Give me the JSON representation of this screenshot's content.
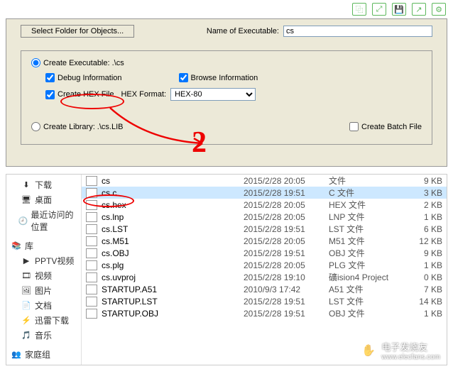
{
  "toolbar": {
    "select_folder": "Select Folder for Objects...",
    "name_of_exec_label": "Name of Executable:",
    "name_of_exec_value": "cs"
  },
  "options": {
    "create_exec_label": "Create Executable:  .\\cs",
    "debug_info_label": "Debug Information",
    "browse_info_label": "Browse Information",
    "create_hex_label": "Create HEX File",
    "hex_format_label": "HEX Format:",
    "hex_format_value": "HEX-80",
    "create_lib_label": "Create Library:  .\\cs.LIB",
    "create_batch_label": "Create Batch File"
  },
  "annotation": {
    "number": "2"
  },
  "nav": {
    "downloads": "下载",
    "desktop": "桌面",
    "recent": "最近访问的位置",
    "libraries": "库",
    "pptv": "PPTV视频",
    "videos": "视频",
    "pictures": "图片",
    "documents": "文档",
    "thunder": "迅雷下载",
    "music": "音乐",
    "homegroup": "家庭组"
  },
  "files": [
    {
      "name": "cs",
      "date": "2015/2/28 20:05",
      "type": "文件",
      "size": "9 KB"
    },
    {
      "name": "cs.c",
      "date": "2015/2/28 19:51",
      "type": "C 文件",
      "size": "3 KB"
    },
    {
      "name": "cs.hex",
      "date": "2015/2/28 20:05",
      "type": "HEX 文件",
      "size": "2 KB"
    },
    {
      "name": "cs.lnp",
      "date": "2015/2/28 20:05",
      "type": "LNP 文件",
      "size": "1 KB"
    },
    {
      "name": "cs.LST",
      "date": "2015/2/28 19:51",
      "type": "LST 文件",
      "size": "6 KB"
    },
    {
      "name": "cs.M51",
      "date": "2015/2/28 20:05",
      "type": "M51 文件",
      "size": "12 KB"
    },
    {
      "name": "cs.OBJ",
      "date": "2015/2/28 19:51",
      "type": "OBJ 文件",
      "size": "9 KB"
    },
    {
      "name": "cs.plg",
      "date": "2015/2/28 20:05",
      "type": "PLG 文件",
      "size": "1 KB"
    },
    {
      "name": "cs.uvproj",
      "date": "2015/2/28 19:10",
      "type": "礦ision4 Project",
      "size": "0 KB"
    },
    {
      "name": "STARTUP.A51",
      "date": "2010/9/3 17:42",
      "type": "A51 文件",
      "size": "7 KB"
    },
    {
      "name": "STARTUP.LST",
      "date": "2015/2/28 19:51",
      "type": "LST 文件",
      "size": "14 KB"
    },
    {
      "name": "STARTUP.OBJ",
      "date": "2015/2/28 19:51",
      "type": "OBJ 文件",
      "size": "1 KB"
    }
  ],
  "watermark": {
    "text": "电子发烧友",
    "site": "www.elecfans.com"
  }
}
